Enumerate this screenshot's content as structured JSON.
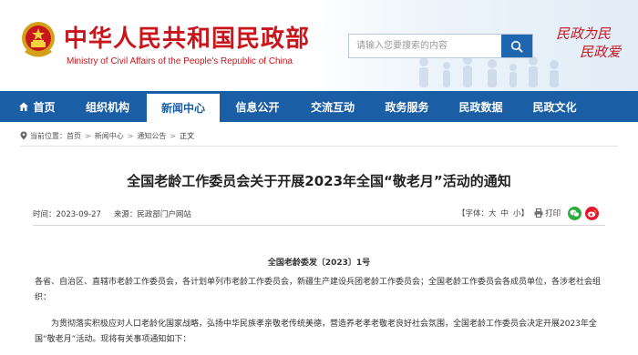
{
  "header": {
    "site_title": "中华人民共和国民政部",
    "site_subtitle": "Ministry of Civil Affairs of the People's Republic of China",
    "emblem_icon": "national-emblem-icon",
    "brand_color": "#c8161d",
    "search": {
      "placeholder": "请输入您要搜索的内容",
      "button_icon": "search-icon"
    },
    "slogan": {
      "line1": "民政为民",
      "line2": "民政爱"
    }
  },
  "nav": {
    "color": "#1a5ea6",
    "items": [
      {
        "label": "首页",
        "icon": "home-icon"
      },
      {
        "label": "组织机构"
      },
      {
        "label": "新闻中心",
        "active": true
      },
      {
        "label": "信息公开"
      },
      {
        "label": "交流互动"
      },
      {
        "label": "政务服务"
      },
      {
        "label": "民政数据"
      },
      {
        "label": "民政文化"
      }
    ]
  },
  "breadcrumb": {
    "prefix": "当前位置：",
    "icon": "location-pin-icon",
    "items": [
      "首页",
      "新闻中心",
      "通知公告"
    ],
    "current": "正文",
    "separator": ">"
  },
  "article": {
    "title": "全国老龄工作委员会关于开展2023年全国“敬老月”活动的通知",
    "time_label": "时间：2023-09-27",
    "source_label": "来源：民政部门户网站",
    "font_size": {
      "prefix": "【字体：",
      "large": "大",
      "medium": "中",
      "small": "小",
      "suffix": "】"
    },
    "print_label": "打印",
    "share_icons": [
      "wechat-icon",
      "weibo-icon"
    ],
    "doc_number": "全国老龄委发〔2023〕1号",
    "paragraphs": [
      "各省、自治区、直辖市老龄工作委员会，各计划单列市老龄工作委员会，新疆生产建设兵团老龄工作委员会；全国老龄工作委员会各成员单位，各涉老社会组织：",
      "为贯彻落实积极应对人口老龄化国家战略，弘扬中华民族孝亲敬老传统美德，营造养老孝老敬老良好社会氛围，全国老龄工作委员会决定开展2023年全国“敬老月”活动。现将有关事项通知如下："
    ]
  }
}
